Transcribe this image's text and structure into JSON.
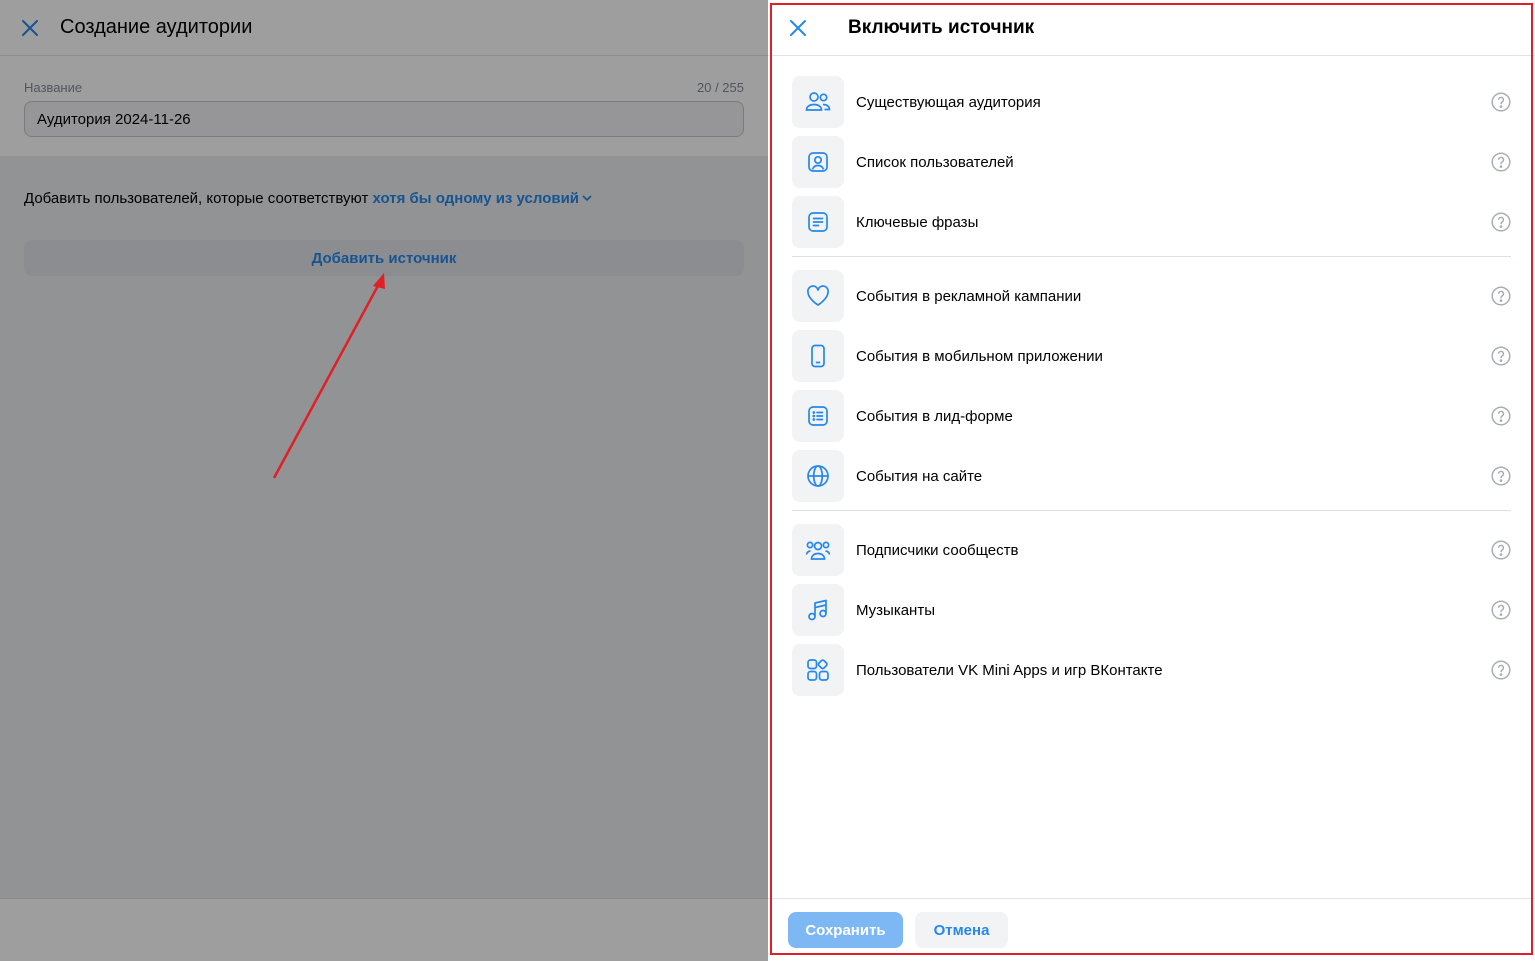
{
  "left_page": {
    "title": "Создание аудитории",
    "name_label": "Название",
    "name_counter": "20 / 255",
    "name_value": "Аудитория 2024-11-26",
    "condition_prefix": "Добавить пользователей, которые соответствуют",
    "condition_link": "хотя бы одному из условий",
    "add_source_label": "Добавить источник"
  },
  "panel": {
    "title": "Включить источник",
    "groups": [
      [
        {
          "label": "Существующая аудитория",
          "icon": "users-icon"
        },
        {
          "label": "Список пользователей",
          "icon": "user-card-icon"
        },
        {
          "label": "Ключевые фразы",
          "icon": "text-lines-icon"
        }
      ],
      [
        {
          "label": "События в рекламной кампании",
          "icon": "heart-icon"
        },
        {
          "label": "События в мобильном приложении",
          "icon": "phone-icon"
        },
        {
          "label": "События в лид-форме",
          "icon": "list-form-icon"
        },
        {
          "label": "События на сайте",
          "icon": "globe-icon"
        }
      ],
      [
        {
          "label": "Подписчики сообществ",
          "icon": "community-icon"
        },
        {
          "label": "Музыканты",
          "icon": "music-note-icon"
        },
        {
          "label": "Пользователи VK Mini Apps и игр ВКонтакте",
          "icon": "apps-icon"
        }
      ]
    ],
    "save_label": "Сохранить",
    "cancel_label": "Отмена"
  },
  "colors": {
    "accent": "#2688eb",
    "save_disabled": "#7db8f5",
    "annotation_red": "#e01f26"
  }
}
